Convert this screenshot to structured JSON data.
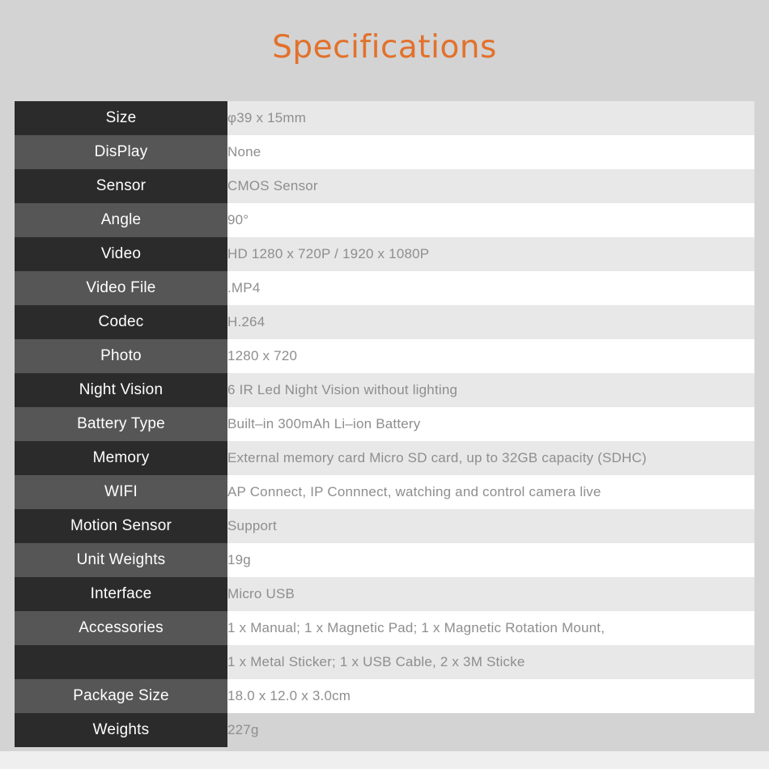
{
  "page": {
    "title": "Specifications",
    "title_color": "#e2712c",
    "background_color": "#d3d3d3"
  },
  "table": {
    "label_column_dark_color": "#2b2b2b",
    "label_column_medium_color": "#565656",
    "value_column_light_color": "#e8e8e8",
    "value_column_white_color": "#ffffff",
    "rows": [
      {
        "label": "Size",
        "value": "φ39 x 15mm"
      },
      {
        "label": "DisPlay",
        "value": "None"
      },
      {
        "label": "Sensor",
        "value": "CMOS Sensor"
      },
      {
        "label": "Angle",
        "value": "90°"
      },
      {
        "label": "Video",
        "value": "HD 1280 x 720P / 1920 x 1080P"
      },
      {
        "label": "Video File",
        "value": ".MP4"
      },
      {
        "label": "Codec",
        "value": "H.264"
      },
      {
        "label": "Photo",
        "value": "1280 x 720"
      },
      {
        "label": "Night Vision",
        "value": "6 IR Led Night Vision without lighting"
      },
      {
        "label": "Battery Type",
        "value": "Built–in 300mAh Li–ion Battery"
      },
      {
        "label": "Memory",
        "value": "External memory card Micro SD card, up to 32GB capacity (SDHC)"
      },
      {
        "label": "WIFI",
        "value": "AP Connect,  IP Connnect, watching and control camera live"
      },
      {
        "label": "Motion Sensor",
        "value": "Support"
      },
      {
        "label": "Unit Weights",
        "value": "19g"
      },
      {
        "label": "Interface",
        "value": "Micro USB"
      },
      {
        "label": "Accessories",
        "value": "1 x Manual; 1 x Magnetic Pad; 1 x Magnetic Rotation Mount,"
      },
      {
        "label": "",
        "value": "1 x Metal Sticker; 1 x USB Cable, 2 x 3M Sticke"
      },
      {
        "label": "Package Size",
        "value": "18.0 x 12.0 x 3.0cm"
      },
      {
        "label": "Weights",
        "value": "227g"
      }
    ]
  }
}
